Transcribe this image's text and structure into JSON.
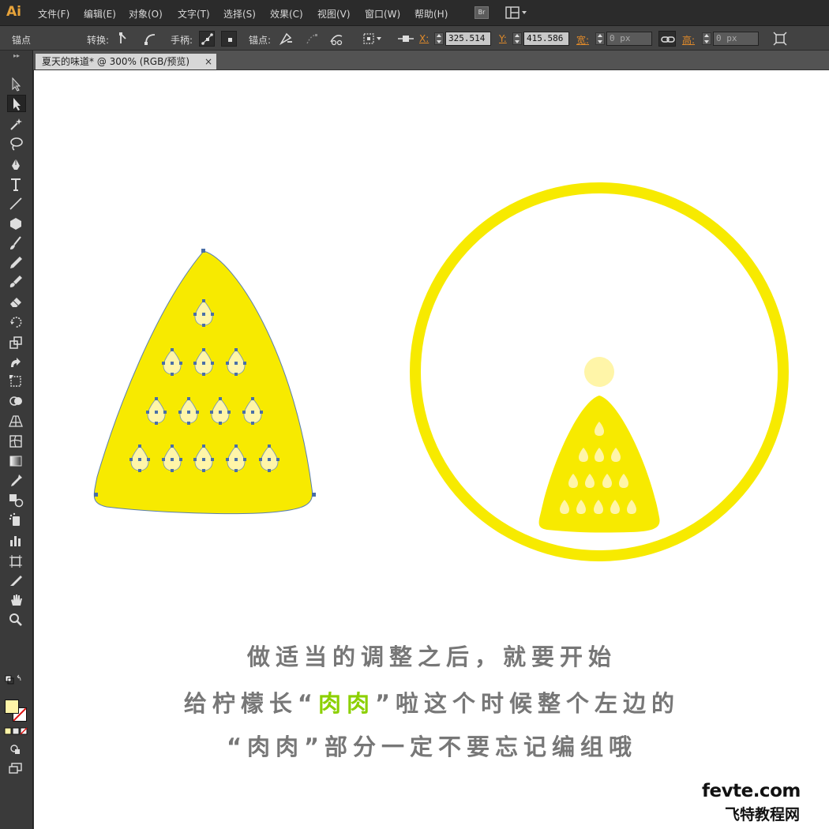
{
  "app": {
    "logo": "Ai"
  },
  "menu": {
    "items": [
      "文件(F)",
      "编辑(E)",
      "对象(O)",
      "文字(T)",
      "选择(S)",
      "效果(C)",
      "视图(V)",
      "窗口(W)",
      "帮助(H)"
    ],
    "bridge_label": "Br"
  },
  "controlbar": {
    "anchor_label": "锚点",
    "convert_label": "转换:",
    "handles_label": "手柄:",
    "anchors_label": "锚点:",
    "x_label": "X:",
    "x_value": "325.514",
    "y_label": "Y:",
    "y_value": "415.586",
    "width_label": "宽:",
    "width_value": "0 px",
    "height_label": "高:",
    "height_value": "0 px"
  },
  "document": {
    "tab_title": "夏天的味道* @ 300% (RGB/预览)",
    "close_glyph": "×"
  },
  "tools": [
    "selection-tool",
    "direct-selection-tool",
    "magic-wand-tool",
    "lasso-tool",
    "pen-tool",
    "type-tool",
    "line-tool",
    "polygon-tool",
    "paintbrush-tool",
    "pencil-tool",
    "blob-brush-tool",
    "eraser-tool",
    "rotate-tool",
    "scale-tool",
    "warp-tool",
    "free-transform-tool",
    "shape-builder-tool",
    "perspective-grid-tool",
    "mesh-tool",
    "gradient-tool",
    "eyedropper-tool",
    "blend-tool",
    "symbol-sprayer-tool",
    "column-graph-tool",
    "artboard-tool",
    "slice-tool",
    "hand-tool",
    "zoom-tool"
  ],
  "colors": {
    "lemon": "#f7ea00",
    "pulp": "#fff5a8",
    "anchor": "#4a6fa8",
    "fill_swatch": "#fff5a8",
    "highlight": "#8cd000",
    "caption": "#777777"
  },
  "caption": {
    "line1": "做适当的调整之后，就要开始",
    "line2_pre": "给柠檬长“",
    "line2_hl": "肉肉",
    "line2_post": "”啦这个时候整个左边的",
    "line3": "“肉肉”部分一定不要忘记编组哦"
  },
  "watermark": {
    "en": "fevte.com",
    "cn": "飞特教程网"
  }
}
